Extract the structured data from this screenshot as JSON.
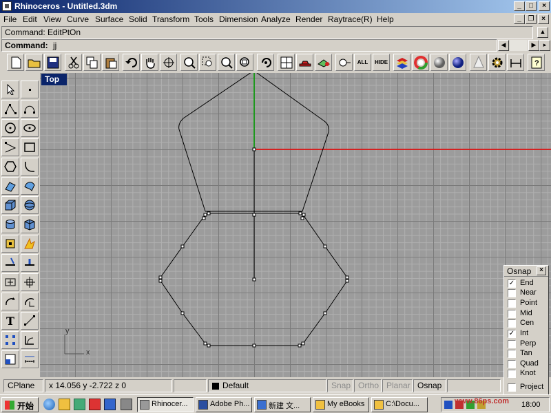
{
  "window": {
    "title": "Rhinoceros - Untitled.3dm"
  },
  "caption_buttons": {
    "minimize": "_",
    "maximize": "□",
    "close": "×"
  },
  "menu": [
    "File",
    "Edit",
    "View",
    "Curve",
    "Surface",
    "Solid",
    "Transform",
    "Tools",
    "Dimension",
    "Analyze",
    "Render",
    "Raytrace(R)",
    "Help"
  ],
  "mdi_buttons": {
    "minimize": "_",
    "restore": "❐",
    "close": "×"
  },
  "command": {
    "history": "Command: EditPtOn",
    "label": "Command:",
    "input": "jj"
  },
  "toolbar_text": {
    "all": "ALL",
    "hide": "HIDE"
  },
  "viewport": {
    "label": "Top",
    "axis_x": "x",
    "axis_y": "y"
  },
  "osnap": {
    "title": "Osnap",
    "close": "×",
    "items": [
      {
        "label": "End",
        "checked": true
      },
      {
        "label": "Near",
        "checked": false
      },
      {
        "label": "Point",
        "checked": false
      },
      {
        "label": "Mid",
        "checked": false
      },
      {
        "label": "Cen",
        "checked": false
      },
      {
        "label": "Int",
        "checked": true
      },
      {
        "label": "Perp",
        "checked": false
      },
      {
        "label": "Tan",
        "checked": false
      },
      {
        "label": "Quad",
        "checked": false
      },
      {
        "label": "Knot",
        "checked": false
      },
      {
        "label": "Project",
        "checked": false
      }
    ]
  },
  "status": {
    "cplane": "CPlane",
    "coords": "x 14.056   y -2.722   z 0",
    "layer": "Default",
    "layer_color": "#000000",
    "snap": "Snap",
    "ortho": "Ortho",
    "planar": "Planar",
    "osnap": "Osnap"
  },
  "taskbar": {
    "start": "开始",
    "tasks": [
      "Rhinocer...",
      "Adobe Ph...",
      "新建 文...",
      "My eBooks",
      "C:\\Docu..."
    ],
    "clock": "18:00"
  },
  "watermark": "www.86ps.com"
}
